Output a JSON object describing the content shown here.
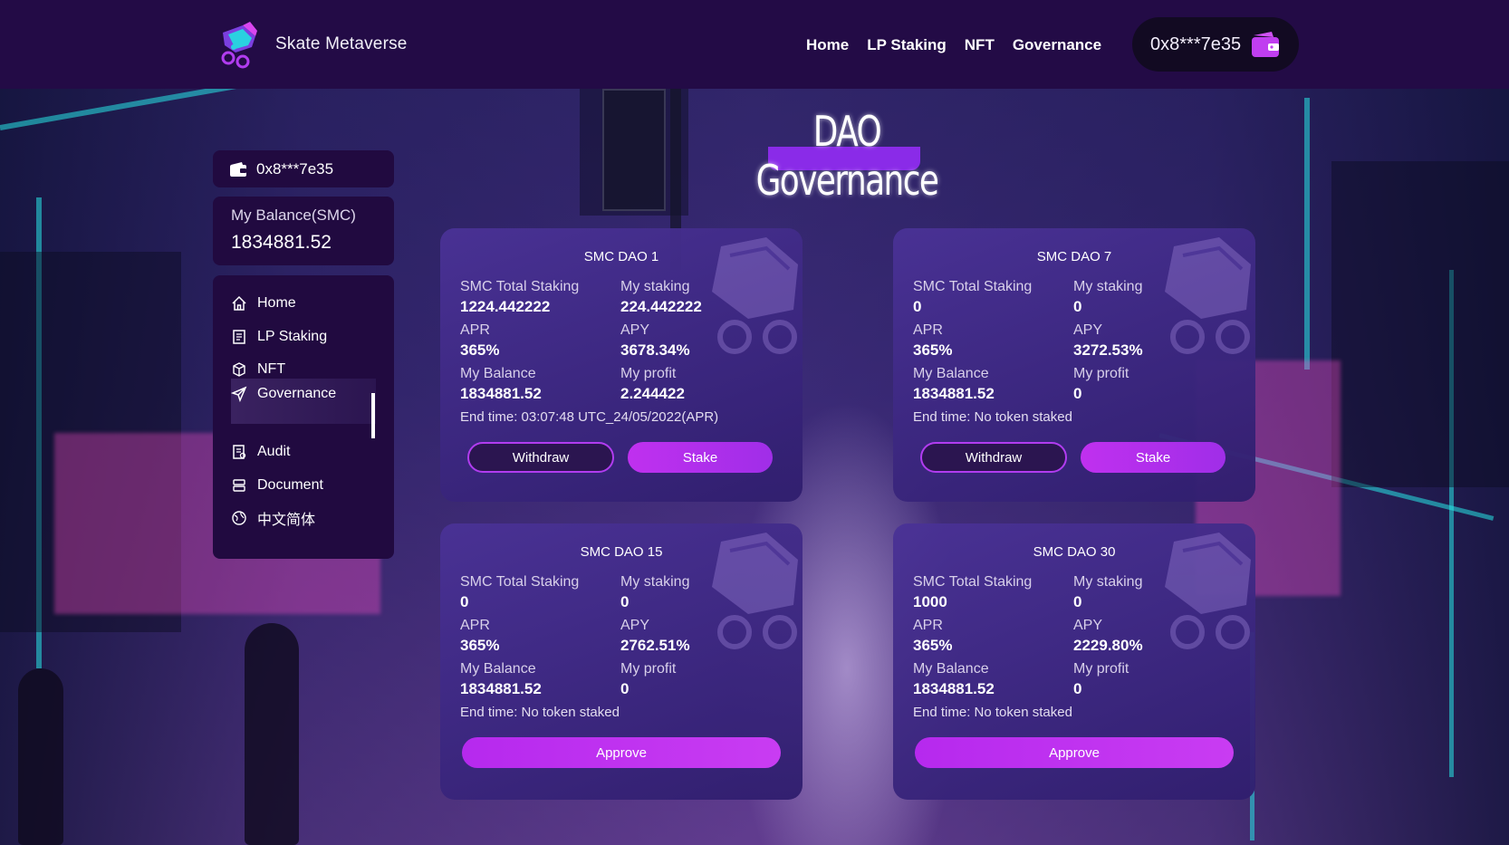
{
  "header": {
    "brand": "Skate Metaverse",
    "nav": [
      "Home",
      "LP Staking",
      "NFT",
      "Governance"
    ],
    "wallet_address": "0x8***7e35"
  },
  "page_title": "DAO Governance",
  "sidebar": {
    "wallet_address": "0x8***7e35",
    "balance_label": "My Balance(SMC)",
    "balance_value": "1834881.52",
    "items": [
      {
        "label": "Home",
        "icon": "home-icon"
      },
      {
        "label": "LP Staking",
        "icon": "document-icon"
      },
      {
        "label": "NFT",
        "icon": "cube-icon"
      },
      {
        "label": "Governance",
        "icon": "send-icon",
        "active": true
      },
      {
        "label": "Audit",
        "icon": "audit-icon"
      },
      {
        "label": "Document",
        "icon": "database-icon"
      },
      {
        "label": "中文简体",
        "icon": "globe-icon"
      }
    ]
  },
  "labels": {
    "total_staking": "SMC Total Staking",
    "my_staking": "My staking",
    "apr": "APR",
    "apy": "APY",
    "my_balance": "My Balance",
    "my_profit": "My profit",
    "withdraw": "Withdraw",
    "stake": "Stake",
    "approve": "Approve"
  },
  "cards": [
    {
      "title": "SMC DAO 1",
      "total_staking": "1224.442222",
      "my_staking": "224.442222",
      "apr": "365%",
      "apy": "3678.34%",
      "my_balance": "1834881.52",
      "my_profit": "2.244422",
      "end_time": "End time: 03:07:48 UTC_24/05/2022(APR)"
    },
    {
      "title": "SMC DAO 7",
      "total_staking": "0",
      "my_staking": "0",
      "apr": "365%",
      "apy": "3272.53%",
      "my_balance": "1834881.52",
      "my_profit": "0",
      "end_time": "End time: No token staked"
    },
    {
      "title": "SMC DAO 15",
      "total_staking": "0",
      "my_staking": "0",
      "apr": "365%",
      "apy": "2762.51%",
      "my_balance": "1834881.52",
      "my_profit": "0",
      "end_time": "End time: No token staked"
    },
    {
      "title": "SMC DAO 30",
      "total_staking": "1000",
      "my_staking": "0",
      "apr": "365%",
      "apy": "2229.80%",
      "my_balance": "1834881.52",
      "my_profit": "0",
      "end_time": "End time: No token staked"
    }
  ],
  "colors": {
    "accent": "#b13cf0",
    "header_bg": "#230b46",
    "panel_bg": "#210a40"
  }
}
